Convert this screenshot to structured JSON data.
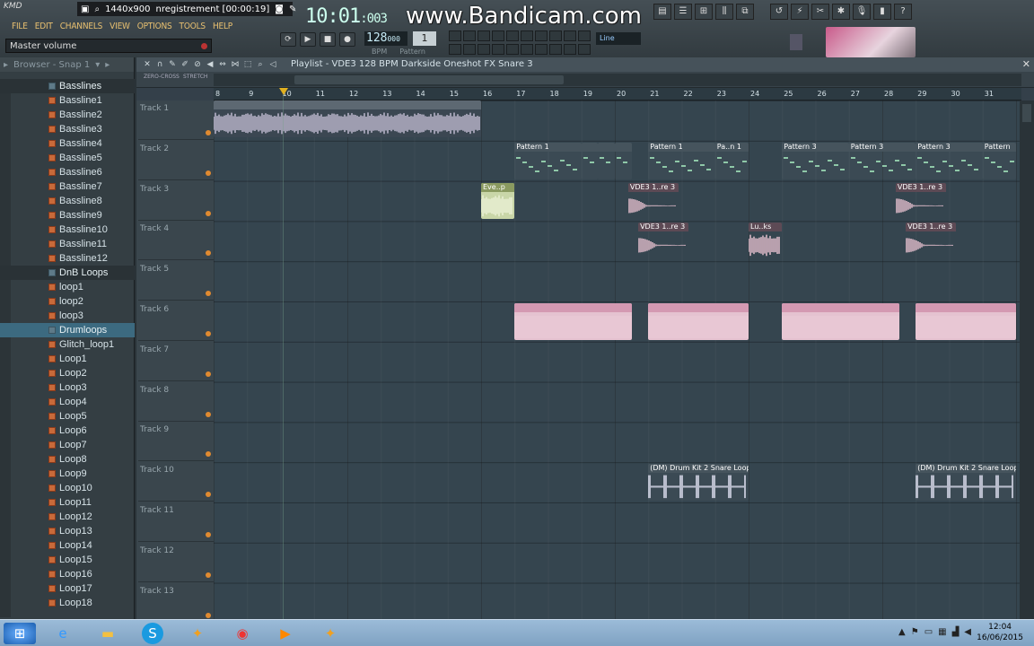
{
  "app": {
    "menus": [
      "FILE",
      "EDIT",
      "CHANNELS",
      "VIEW",
      "OPTIONS",
      "TOOLS",
      "HELP"
    ],
    "hint": "Master volume",
    "time": "10:01",
    "time_ms": ":003",
    "bpm": "128",
    "bpm_frac": "000",
    "pattern": "1",
    "bpm_label": "BPM",
    "pattern_label": "Pattern",
    "line_mode": "Line"
  },
  "recorder": {
    "resolution": "1440x900",
    "status": "nregistrement [00:00:19]",
    "watermark": "www.Bandicam.com"
  },
  "browser": {
    "title": "Browser - Snap 1",
    "items": [
      {
        "label": "Basslines",
        "type": "folder"
      },
      {
        "label": "Bassline1",
        "type": "file"
      },
      {
        "label": "Bassline2",
        "type": "file"
      },
      {
        "label": "Bassline3",
        "type": "file"
      },
      {
        "label": "Bassline4",
        "type": "file"
      },
      {
        "label": "Bassline5",
        "type": "file"
      },
      {
        "label": "Bassline6",
        "type": "file"
      },
      {
        "label": "Bassline7",
        "type": "file"
      },
      {
        "label": "Bassline8",
        "type": "file"
      },
      {
        "label": "Bassline9",
        "type": "file"
      },
      {
        "label": "Bassline10",
        "type": "file"
      },
      {
        "label": "Bassline11",
        "type": "file"
      },
      {
        "label": "Bassline12",
        "type": "file"
      },
      {
        "label": "DnB Loops",
        "type": "folder"
      },
      {
        "label": "loop1",
        "type": "file"
      },
      {
        "label": "loop2",
        "type": "file"
      },
      {
        "label": "loop3",
        "type": "file"
      },
      {
        "label": "Drumloops",
        "type": "open"
      },
      {
        "label": "Glitch_loop1",
        "type": "file"
      },
      {
        "label": "Loop1",
        "type": "file"
      },
      {
        "label": "Loop2",
        "type": "file"
      },
      {
        "label": "Loop3",
        "type": "file"
      },
      {
        "label": "Loop4",
        "type": "file"
      },
      {
        "label": "Loop5",
        "type": "file"
      },
      {
        "label": "Loop6",
        "type": "file"
      },
      {
        "label": "Loop7",
        "type": "file"
      },
      {
        "label": "Loop8",
        "type": "file"
      },
      {
        "label": "Loop9",
        "type": "file"
      },
      {
        "label": "Loop10",
        "type": "file"
      },
      {
        "label": "Loop11",
        "type": "file"
      },
      {
        "label": "Loop12",
        "type": "file"
      },
      {
        "label": "Loop13",
        "type": "file"
      },
      {
        "label": "Loop14",
        "type": "file"
      },
      {
        "label": "Loop15",
        "type": "file"
      },
      {
        "label": "Loop16",
        "type": "file"
      },
      {
        "label": "Loop17",
        "type": "file"
      },
      {
        "label": "Loop18",
        "type": "file"
      }
    ]
  },
  "playlist": {
    "title": "Playlist - VDE3 128 BPM Darkside Oneshot FX Snare 3",
    "toggles": [
      "ZERO-CROSS",
      "STRETCH"
    ],
    "ruler": [
      "8",
      "9",
      "10",
      "11",
      "12",
      "13",
      "14",
      "15",
      "16",
      "17",
      "18",
      "19",
      "20",
      "21",
      "22",
      "23",
      "24",
      "25",
      "26",
      "27",
      "28",
      "29",
      "30",
      "31"
    ],
    "tracks": [
      "Track 1",
      "Track 2",
      "Track 3",
      "Track 4",
      "Track 5",
      "Track 6",
      "Track 7",
      "Track 8",
      "Track 9",
      "Track 10",
      "Track 11",
      "Track 12",
      "Track 13"
    ],
    "clips": [
      {
        "track": 0,
        "start": 8,
        "len": 8,
        "label": "",
        "kind": "audio"
      },
      {
        "track": 1,
        "start": 17,
        "len": 2,
        "label": "Pattern 1",
        "kind": "pat"
      },
      {
        "track": 1,
        "start": 19,
        "len": 0.5,
        "label": "",
        "kind": "pat"
      },
      {
        "track": 1,
        "start": 19.5,
        "len": 0.5,
        "label": "",
        "kind": "pat"
      },
      {
        "track": 1,
        "start": 20,
        "len": 0.5,
        "label": "",
        "kind": "pat"
      },
      {
        "track": 1,
        "start": 21,
        "len": 2,
        "label": "Pattern 1",
        "kind": "pat"
      },
      {
        "track": 1,
        "start": 23,
        "len": 1,
        "label": "Pa..n 1",
        "kind": "pat"
      },
      {
        "track": 1,
        "start": 25,
        "len": 2,
        "label": "Pattern 3",
        "kind": "pat"
      },
      {
        "track": 1,
        "start": 27,
        "len": 2,
        "label": "Pattern 3",
        "kind": "pat"
      },
      {
        "track": 1,
        "start": 29,
        "len": 2,
        "label": "Pattern 3",
        "kind": "pat"
      },
      {
        "track": 1,
        "start": 31,
        "len": 1,
        "label": "Pattern",
        "kind": "pat"
      },
      {
        "track": 2,
        "start": 16,
        "len": 1,
        "label": "Eve..p",
        "kind": "green"
      },
      {
        "track": 2,
        "start": 20.4,
        "len": 1.5,
        "label": "VDE3 1..re 3",
        "kind": "sample"
      },
      {
        "track": 2,
        "start": 28.4,
        "len": 1.5,
        "label": "VDE3 1..re 3",
        "kind": "sample"
      },
      {
        "track": 3,
        "start": 20.7,
        "len": 1.5,
        "label": "VDE3 1..re 3",
        "kind": "sample"
      },
      {
        "track": 3,
        "start": 24,
        "len": 1,
        "label": "Lu..ks",
        "kind": "sample"
      },
      {
        "track": 3,
        "start": 28.7,
        "len": 1.5,
        "label": "VDE3 1..re 3",
        "kind": "sample"
      },
      {
        "track": 5,
        "start": 17,
        "len": 3.5,
        "label": "",
        "kind": "auto"
      },
      {
        "track": 5,
        "start": 21,
        "len": 3,
        "label": "",
        "kind": "auto"
      },
      {
        "track": 5,
        "start": 25,
        "len": 3.5,
        "label": "",
        "kind": "auto"
      },
      {
        "track": 5,
        "start": 29,
        "len": 3,
        "label": "",
        "kind": "auto"
      },
      {
        "track": 9,
        "start": 21,
        "len": 3,
        "label": "(DM) Drum Kit 2 Snare Loop",
        "kind": "spiky"
      },
      {
        "track": 9,
        "start": 29,
        "len": 3,
        "label": "(DM) Drum Kit 2 Snare Loop",
        "kind": "spiky"
      }
    ]
  },
  "taskbar": {
    "time": "12:04",
    "date": "16/06/2015"
  }
}
